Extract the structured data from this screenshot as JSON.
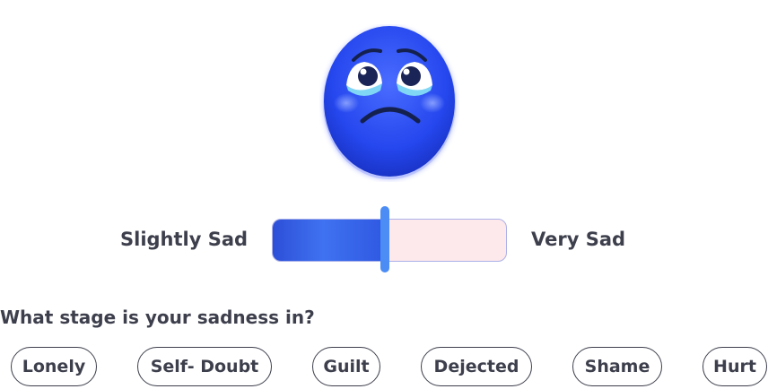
{
  "mood": {
    "icon": "sad-crying-face-icon",
    "face_color": "#2f4ff0"
  },
  "scale": {
    "left_label": "Slightly Sad",
    "right_label": "Very Sad",
    "level": 0.48,
    "fill_color": "#3f6cf0",
    "track_color": "#fde8ec",
    "handle_color": "#4b8cf5"
  },
  "question": "What stage is your sadness in?",
  "options": [
    "Lonely",
    "Self- Doubt",
    "Guilt",
    "Dejected",
    "Shame",
    "Hurt"
  ]
}
